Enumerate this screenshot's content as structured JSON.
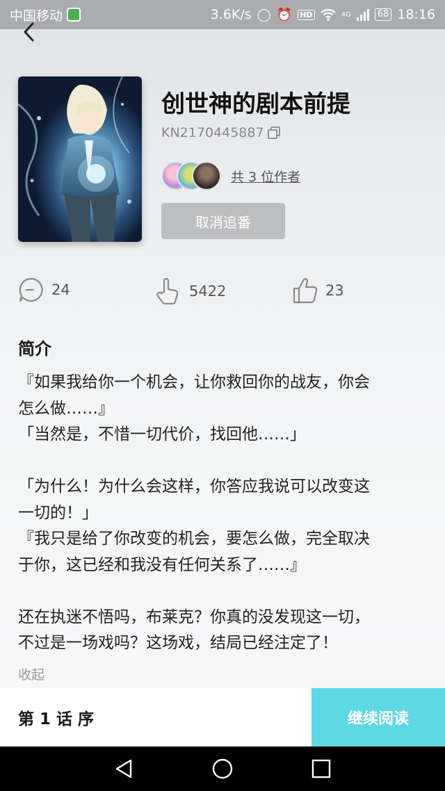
{
  "status_bar": {
    "carrier": "中国移动",
    "speed": "3.6K/s",
    "network": "4G",
    "hd_label": "HD",
    "battery": "68",
    "time": "18:16"
  },
  "book": {
    "title": "创世神的剧本前提",
    "code": "KN2170445887",
    "authors_text": "共 3 位作者",
    "unfollow_label": "取消追番"
  },
  "stats": {
    "comments": "24",
    "likes": "5422",
    "thumbs": "23"
  },
  "intro": {
    "heading": "简介",
    "lines": [
      "『如果我给你一个机会，让你救回你的战友，你会",
      "怎么做……』",
      "「当然是，不惜一切代价，找回他……」",
      "",
      "「为什么！为什么会这样，你答应我说可以改变这",
      "一切的！」",
      "『我只是给了你改变的机会，要怎么做，完全取决",
      "于你，这已经和我没有任何关系了……』",
      "",
      "还在执迷不悟吗，布莱克？你真的没发现这一切，",
      "不过是一场戏吗？这场戏，结局已经注定了！"
    ],
    "collapse_label": "收起"
  },
  "bottom_bar": {
    "chapter_label": "第 1 话 序",
    "continue_label": "继续阅读"
  },
  "colors": {
    "accent": "#5ed9e4",
    "button_gray": "#bdbec0",
    "status_bar": "#a9abae"
  },
  "icons": {
    "back": "chevron-left-icon",
    "copy": "copy-icon",
    "comment": "comment-icon",
    "like": "hand-tap-icon",
    "thumb": "thumbs-up-icon",
    "nav_back": "triangle-back-icon",
    "nav_home": "circle-home-icon",
    "nav_recent": "square-recent-icon"
  }
}
